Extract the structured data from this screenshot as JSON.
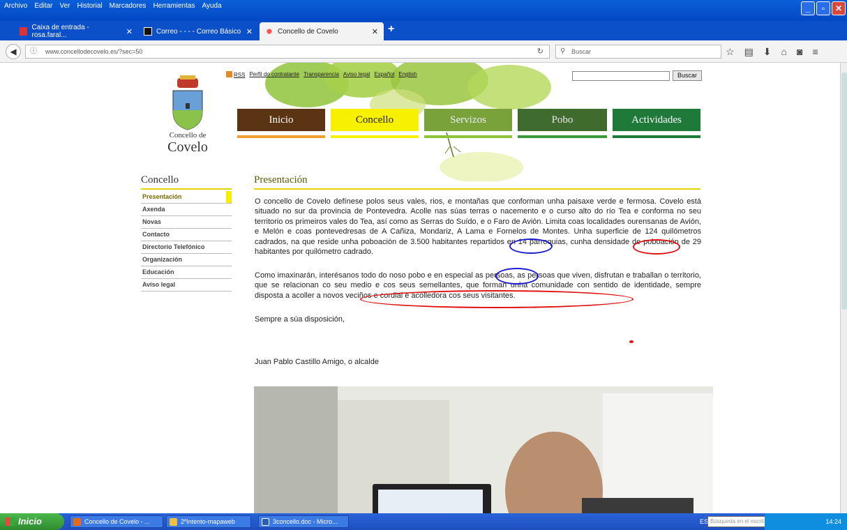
{
  "browser": {
    "menu": [
      "Archivo",
      "Editar",
      "Ver",
      "Historial",
      "Marcadores",
      "Herramientas",
      "Ayuda"
    ],
    "tabs": [
      {
        "label": "Caixa de entrada - rosa.faral..."
      },
      {
        "label": "Correo - - - - Correo Básico"
      },
      {
        "label": "Concello de Covelo"
      }
    ],
    "url": "www.concellodecovelo.es/?sec=50",
    "search_placeholder": "Buscar"
  },
  "site": {
    "brand_line1": "Concello de",
    "brand_line2": "Covelo",
    "toplinks": [
      "RSS",
      "Perfil do contratante",
      "Transparencia",
      "Aviso legal",
      "Español",
      "English"
    ],
    "search_button": "Buscar",
    "nav": [
      "Inicio",
      "Concello",
      "Servizos",
      "Pobo",
      "Actividades"
    ],
    "colors": {
      "nav_inicio": "#5b3413",
      "nav_concello": "#f7f000",
      "nav_servizos": "#7aa23a",
      "nav_pobo": "#3f6b2e",
      "nav_actividades": "#1f7a3a",
      "accent_line": "#e3d400"
    },
    "sidebar": {
      "title": "Concello",
      "items": [
        "Presentación",
        "Axenda",
        "Novas",
        "Contacto",
        "Directorio Telefónico",
        "Organización",
        "Educación",
        "Aviso legal"
      ]
    },
    "main": {
      "title": "Presentación",
      "p1": "O concello de Covelo defínese polos seus vales, rios, e montañas que conforman unha paisaxe verde e fermosa. Covelo está situado no sur da provincia de Pontevedra. Acolle nas súas terras o nacemento e o curso alto do río Tea e conforma no seu territorio os primeiros vales do Tea, así como as Serras do Suído, e o Faro de Avión. Limita coas localidades ourensanas de Avión, e Melón e coas pontevedresas de A Cañiza, Mondariz, A Lama e Fornelos de Montes. Unha superficie de 124 quilómetros cadrados, na que reside unha poboación de 3.500 habitantes repartidos en 14 parroquias, cunha densidade de poboación de 29 habitantes por quilómetro cadrado.",
      "p2": "Como imaxinarán, interésanos todo do noso pobo e en especial as persoas, as persoas que viven, disfrutan e traballan o territorio, que se relacionan co seu medio e cos seus semellantes, que forman unha comunidade con sentido de identidade, sempre disposta a acoller a novos veciños e cordial e acolledora cos seus visitantes.",
      "p3": "Sempre a súa disposición,",
      "signature": "Juan Pablo Castillo Amigo, o alcalde"
    }
  },
  "taskbar": {
    "start": "Inicio",
    "items": [
      "Concello de Covelo - ...",
      "2ºIntento-mapaweb",
      "3concello.doc - Micro..."
    ],
    "lang": "ES",
    "search_placeholder": "Búsqueda en el escrit",
    "clock": "14:24"
  }
}
